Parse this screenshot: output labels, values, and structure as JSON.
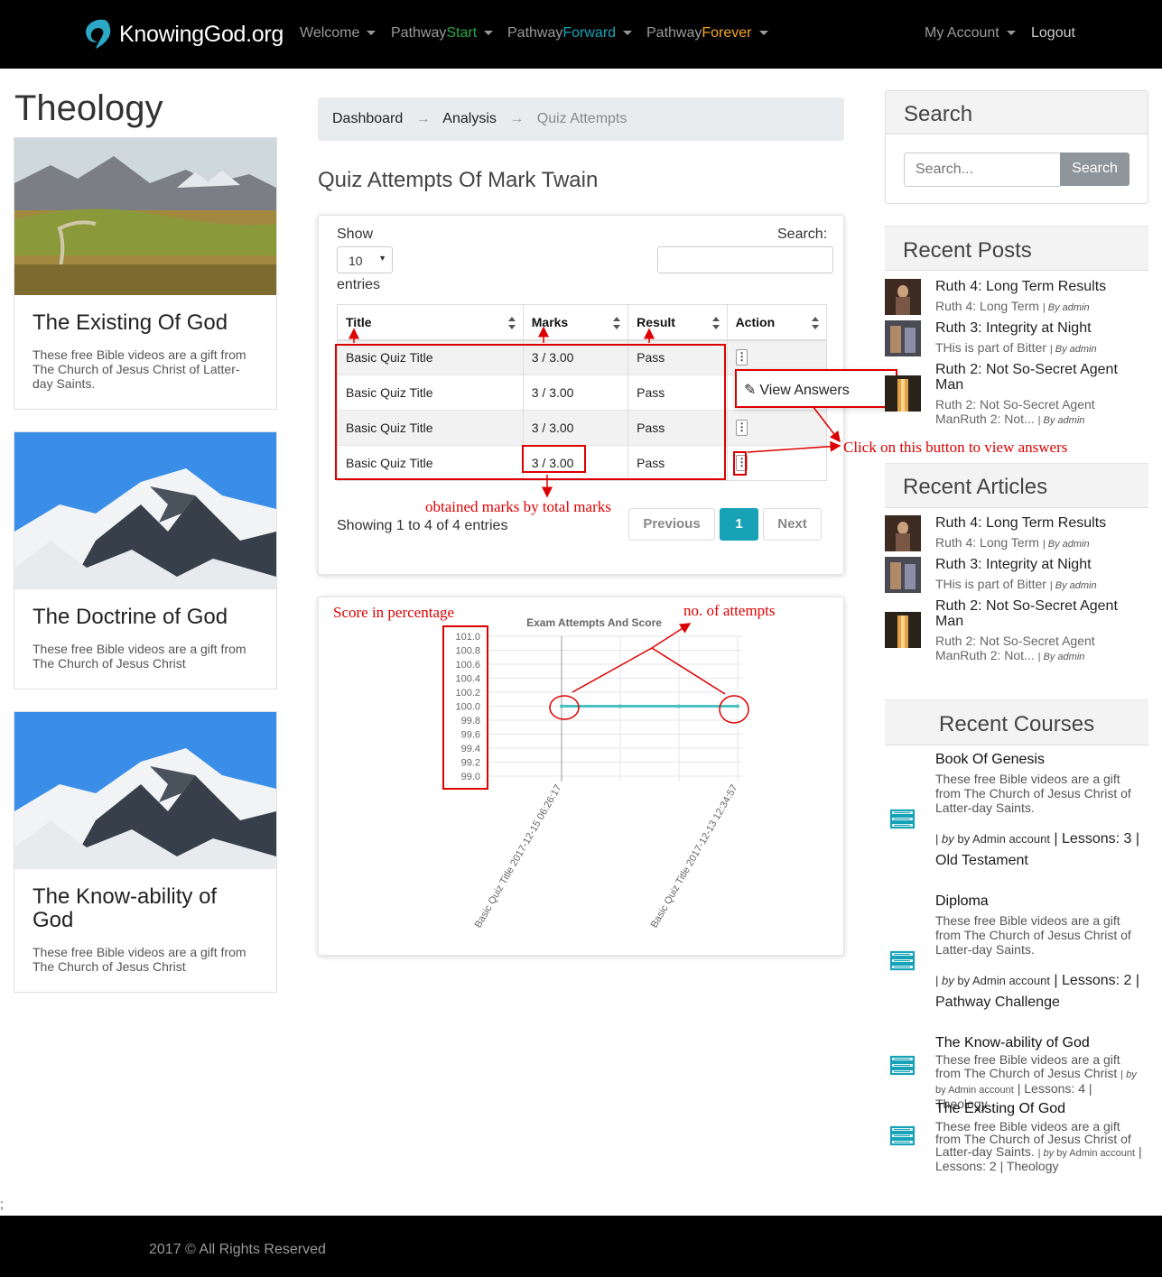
{
  "navbar": {
    "brand": "KnowingGod.org",
    "welcome": "Welcome",
    "start_prefix": "Pathway",
    "start_suffix": "Start",
    "forward_prefix": "Pathway",
    "forward_suffix": "Forward",
    "forever_prefix": "Pathway",
    "forever_suffix": "Forever",
    "account": "My Account",
    "logout": "Logout"
  },
  "left": {
    "heading": "Theology",
    "cards": [
      {
        "title": "The Existing Of God",
        "text": "These free Bible videos are a gift from The Church of Jesus Christ of Latter-day Saints."
      },
      {
        "title": "The Doctrine of God",
        "text": "These free Bible videos are a gift from The Church of Jesus Christ"
      },
      {
        "title": "The Know-ability of God",
        "text": "These free Bible videos are a gift from The Church of Jesus Christ"
      }
    ],
    "stray": ";"
  },
  "breadcrumb": {
    "dashboard": "Dashboard",
    "analysis": "Analysis",
    "current": "Quiz Attempts",
    "arrow": "→"
  },
  "quiz": {
    "heading": "Quiz Attempts Of Mark Twain",
    "show_label": "Show",
    "entries_value": "10",
    "entries_label": "entries",
    "search_label": "Search:",
    "columns": [
      "Title",
      "Marks",
      "Result",
      "Action"
    ],
    "rows": [
      {
        "title": "Basic Quiz Title",
        "marks": "3 / 3.00",
        "result": "Pass"
      },
      {
        "title": "Basic Quiz Title",
        "marks": "3 / 3.00",
        "result": "Pass"
      },
      {
        "title": "Basic Quiz Title",
        "marks": "3 / 3.00",
        "result": "Pass"
      },
      {
        "title": "Basic Quiz Title",
        "marks": "3 / 3.00",
        "result": "Pass"
      }
    ],
    "dropdown_item": "View Answers",
    "info": "Showing 1 to 4 of 4 entries",
    "prev": "Previous",
    "page": "1",
    "next": "Next"
  },
  "annotations": {
    "click_hint": "Click on this button to view answers",
    "marks_hint": "obtained marks by total marks",
    "score_hint": "Score in percentage",
    "attempts_hint": "no. of attempts"
  },
  "colors": {
    "accent": "#17a2b8",
    "annotation": "#dd0000",
    "line": "#4bc0c0"
  },
  "chart_data": {
    "type": "line",
    "title": "Exam Attempts And Score",
    "x": [
      "Basic Quiz Title 2017-12-15 06:26:17",
      "",
      "",
      "Basic Quiz Title 2017-12-13 12:34:57"
    ],
    "series": [
      {
        "values": [
          100,
          100,
          100,
          100
        ]
      }
    ],
    "ylim": [
      99.0,
      101.0
    ],
    "yticks": [
      "101.0",
      "100.8",
      "100.6",
      "100.4",
      "100.2",
      "100.0",
      "99.8",
      "99.6",
      "99.4",
      "99.2",
      "99.0"
    ],
    "grid": true
  },
  "sidebar": {
    "search_title": "Search",
    "search_placeholder": "Search...",
    "search_button": "Search",
    "recent_posts_title": "Recent Posts",
    "recent_posts": [
      {
        "title": "Ruth 4: Long Term Results",
        "excerpt": "Ruth 4: Long Term",
        "by": "By admin"
      },
      {
        "title": "Ruth 3: Integrity at Night",
        "excerpt": "THis is part of Bitter",
        "by": "By admin"
      },
      {
        "title": "Ruth 2: Not So-Secret Agent Man",
        "excerpt": "Ruth 2: Not So-Secret Agent ManRuth 2: Not...",
        "by": "By admin"
      }
    ],
    "recent_articles_title": "Recent Articles",
    "recent_articles": [
      {
        "title": "Ruth 4: Long Term Results",
        "excerpt": "Ruth 4: Long Term",
        "by": "By admin"
      },
      {
        "title": "Ruth 3: Integrity at Night",
        "excerpt": "THis is part of Bitter",
        "by": "By admin"
      },
      {
        "title": "Ruth 2: Not So-Secret Agent Man",
        "excerpt": "Ruth 2: Not So-Secret Agent ManRuth 2: Not...",
        "by": "By admin"
      }
    ],
    "recent_courses_title": "Recent Courses",
    "courses": [
      {
        "title": "Book Of Genesis",
        "text": "These free Bible videos are a gift from The Church of Jesus Christ of Latter-day Saints.",
        "by": "by Admin account",
        "lessons": "Lessons: 3",
        "category": "Old Testament"
      },
      {
        "title": "Diploma",
        "text": "These free Bible videos are a gift from The Church of Jesus Christ of Latter-day Saints.",
        "by": "by Admin account",
        "lessons": "Lessons: 2",
        "category": "Pathway Challenge"
      },
      {
        "title": "The Know-ability of God",
        "text": "These free Bible videos are a gift from The Church of Jesus Christ",
        "by": "by Admin account",
        "lessons": "Lessons: 4",
        "category": "Theology"
      },
      {
        "title": "The Existing Of God",
        "text": "These free Bible videos are a gift from The Church of Jesus Christ of Latter-day Saints.",
        "by": "by Admin account",
        "lessons": "Lessons: 2",
        "category": "Theology"
      }
    ]
  },
  "footer": {
    "text": "2017 © All Rights Reserved"
  }
}
